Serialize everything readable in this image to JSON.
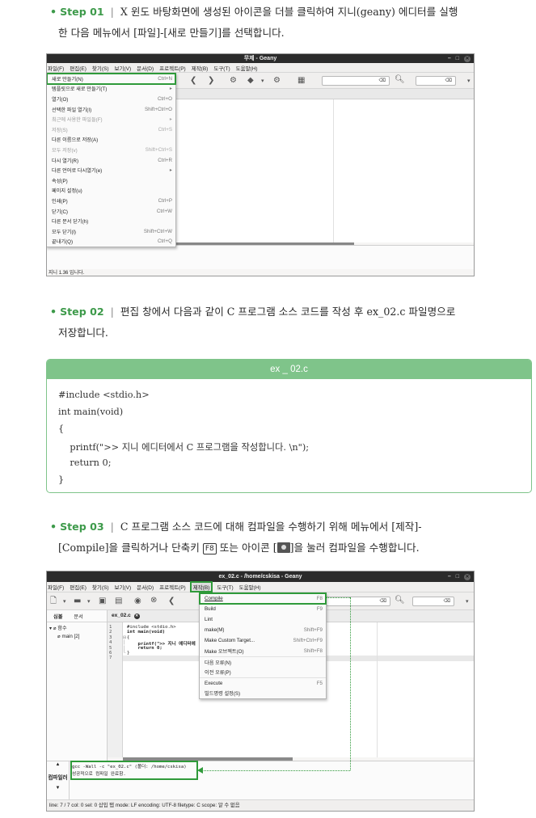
{
  "step1": {
    "bullet": "•",
    "label": "Step 01",
    "sep": "|",
    "line1": "X 윈도 바탕화면에 생성된 아이콘을 더블 클릭하여 지니(geany) 에디터를 실행",
    "line2": "한 다음 메뉴에서 [파일]-[새로 만들기]를 선택합니다."
  },
  "window1": {
    "title": "무제 - Geany",
    "controls": {
      "min": "–",
      "max": "□",
      "close": "✕"
    },
    "menu": [
      "파일(F)",
      "편집(E)",
      "찾기(S)",
      "보기(V)",
      "문서(D)",
      "프로젝트(P)",
      "제작(B)",
      "도구(T)",
      "도움말(H)"
    ],
    "search_value": "⌫",
    "goto_value": "⌫",
    "file_menu": [
      {
        "label": "새로 만들기(N)",
        "shortcut": "Ctrl+N"
      },
      {
        "label": "템플릿으로 새로 만들기(T)",
        "shortcut": "▸"
      },
      {
        "label": "열기(O)",
        "shortcut": "Ctrl+O"
      },
      {
        "label": "선택한 파일 열기(I)",
        "shortcut": "Shift+Ctrl+O"
      },
      {
        "label": "최근에 사용한 파일들(F)",
        "shortcut": "▸"
      },
      {
        "label": "저장(S)",
        "shortcut": "Ctrl+S"
      },
      {
        "label": "다른 이름으로 저장(A)",
        "shortcut": ""
      },
      {
        "label": "모두 저장(v)",
        "shortcut": "Shift+Ctrl+S"
      },
      {
        "label": "다시 열기(R)",
        "shortcut": "Ctrl+R"
      },
      {
        "label": "다른 언어로 다시열기(e)",
        "shortcut": "▸"
      },
      {
        "label": "속성(P)",
        "shortcut": ""
      },
      {
        "label": "페이지 설정(u)",
        "shortcut": ""
      },
      {
        "label": "인쇄(P)",
        "shortcut": "Ctrl+P"
      },
      {
        "label": "닫기(C)",
        "shortcut": "Ctrl+W"
      },
      {
        "label": "다른 문서 닫기(h)",
        "shortcut": ""
      },
      {
        "label": "모두 닫기(l)",
        "shortcut": "Shift+Ctrl+W"
      },
      {
        "label": "끝내기(Q)",
        "shortcut": "Ctrl+Q"
      }
    ],
    "status_text": "지니 1.36 입니다."
  },
  "step2": {
    "bullet": "•",
    "label": "Step 02",
    "sep": "|",
    "line1": "편집 창에서 다음과 같이 C 프로그램 소스 코드를 작성 후 ex_02.c 파일명으로",
    "line2": "저장합니다."
  },
  "codebox": {
    "title": "ex _ 02.c",
    "lines": [
      "#include <stdio.h>",
      "int main(void)",
      "{",
      "    printf(\">> 지니 에디터에서 C 프로그램을 작성합니다. \\n\");",
      "    return 0;",
      "}"
    ]
  },
  "step3": {
    "bullet": "•",
    "label": "Step 03",
    "sep": "|",
    "line1": "C 프로그램 소스 코드에 대해 컴파일을 수행하기 위해 메뉴에서 [제작]-",
    "line2a": "[Compile]을 클릭하거나 단축키",
    "key": "F8",
    "line2b": "또는 아이콘 [",
    "line2c": "]을 눌러 컴파일을 수행합니다."
  },
  "window2": {
    "title": "ex_02.c - /home/cskisa - Geany",
    "controls": {
      "min": "–",
      "max": "□",
      "close": "✕"
    },
    "menu": [
      "파일(F)",
      "편집(E)",
      "찾기(S)",
      "보기(V)",
      "문서(D)",
      "프로젝트(P)",
      "제작(B)",
      "도구(T)",
      "도움말(H)"
    ],
    "search_value": "⌫",
    "goto_value": "⌫",
    "side_tabs": [
      "심볼",
      "문서"
    ],
    "tree_root": "함수",
    "tree_child": "main [2]",
    "doc_tab": "ex_02.c",
    "line_numbers": [
      "1",
      "2",
      "3",
      "4",
      "5",
      "6",
      "7"
    ],
    "code_lines": [
      "#include <stdio.h>",
      "int main(void)",
      "{",
      "    printf(\">> 지니 에디터에",
      "    return 0;",
      "}",
      ""
    ],
    "build_menu": [
      {
        "label": "Compile",
        "shortcut": "F8"
      },
      {
        "label": "Build",
        "shortcut": "F9"
      },
      {
        "label": "Lint",
        "shortcut": ""
      },
      {
        "label": "make(M)",
        "shortcut": "Shift+F9"
      },
      {
        "label": "Make Custom Target...",
        "shortcut": "Shift+Ctrl+F9"
      },
      {
        "label": "Make 오브젝트(O)",
        "shortcut": "Shift+F8"
      },
      {
        "label": "다음 오류(N)",
        "shortcut": ""
      },
      {
        "label": "이전 오류(P)",
        "shortcut": ""
      },
      {
        "label": "Execute",
        "shortcut": "F5"
      },
      {
        "label": "빌드명령 설정(S)",
        "shortcut": ""
      }
    ],
    "msg_tab": "컴파일러",
    "msg_line1": "gcc -Wall -c \"ex_02.c\" (폴더: /home/cskisa)",
    "msg_line2": "성공적으로 컴파일 완료함.",
    "status": "line: 7 / 7    col: 0    sel: 0    삽입    탭    mode: LF    encoding: UTF-8    filetype: C    scope: 알 수 없음"
  }
}
